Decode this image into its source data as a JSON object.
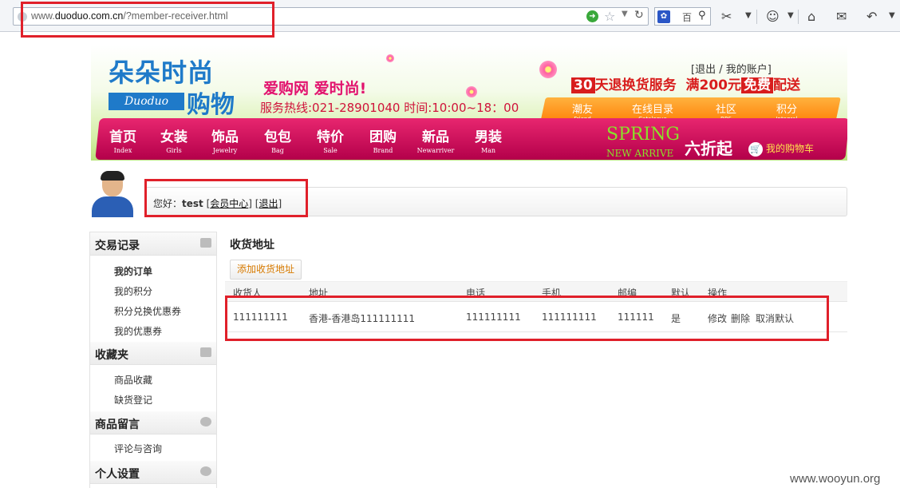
{
  "browser": {
    "url_prefix": "www.",
    "url_domain": "duoduo.com.cn",
    "url_path": "/?member-receiver.html",
    "search_engine_label": "百"
  },
  "header": {
    "logo_line1": "朵朵时尚",
    "logo_line2": "购物",
    "logo_en": "Duoduo",
    "slogan": "爱购网  爱时尚!",
    "hotline": "服务热线:021-28901040 时间:10:00~18：00",
    "account_links": "[退出 / 我的账户]",
    "promo_num": "30",
    "promo_text1": "天退换货服务",
    "promo_text2": "满200元",
    "promo_free": "免费",
    "promo_text3": "配送",
    "orange_nav": [
      {
        "cn": "潮友",
        "en": "Friend"
      },
      {
        "cn": "在线目录",
        "en": "Catalogue"
      },
      {
        "cn": "社区",
        "en": "BBS"
      },
      {
        "cn": "积分",
        "en": "Integral"
      }
    ],
    "main_nav": [
      {
        "cn": "首页",
        "en": "Index"
      },
      {
        "cn": "女装",
        "en": "Girls"
      },
      {
        "cn": "饰品",
        "en": "Jewelry"
      },
      {
        "cn": "包包",
        "en": "Bag"
      },
      {
        "cn": "特价",
        "en": "Sale"
      },
      {
        "cn": "团购",
        "en": "Brand"
      },
      {
        "cn": "新品",
        "en": "Newarriver"
      },
      {
        "cn": "男装",
        "en": "Man"
      }
    ],
    "spring": "SPRING",
    "new_arrive": "NEW ARRIVE",
    "discount": "六折起",
    "cart": "我的购物车"
  },
  "member": {
    "greeting": "您好：",
    "username": "test",
    "center_link": "会员中心",
    "logout_link": "退出"
  },
  "sidebar": {
    "sections": [
      {
        "title": "交易记录",
        "items": [
          "我的订单",
          "我的积分",
          "积分兑换优惠券",
          "我的优惠券"
        ]
      },
      {
        "title": "收藏夹",
        "items": [
          "商品收藏",
          "缺货登记"
        ]
      },
      {
        "title": "商品留言",
        "items": [
          "评论与咨询"
        ]
      },
      {
        "title": "个人设置",
        "items": []
      }
    ]
  },
  "main": {
    "title": "收货地址",
    "add_button": "添加收货地址",
    "columns": [
      "收货人",
      "地址",
      "电话",
      "手机",
      "邮编",
      "默认",
      "操作"
    ],
    "rows": [
      {
        "name": "111111111",
        "address": "香港-香港岛111111111",
        "phone": "111111111",
        "mobile": "111111111",
        "zip": "111111",
        "default": "是",
        "actions": [
          "修改",
          "删除",
          "取消默认"
        ]
      }
    ]
  },
  "watermark": "www.wooyun.org",
  "colors": {
    "annotation": "#e0202a",
    "nav_magenta": "#c8005a",
    "nav_orange": "#ff8a00",
    "logo_blue": "#1f7ac9"
  }
}
